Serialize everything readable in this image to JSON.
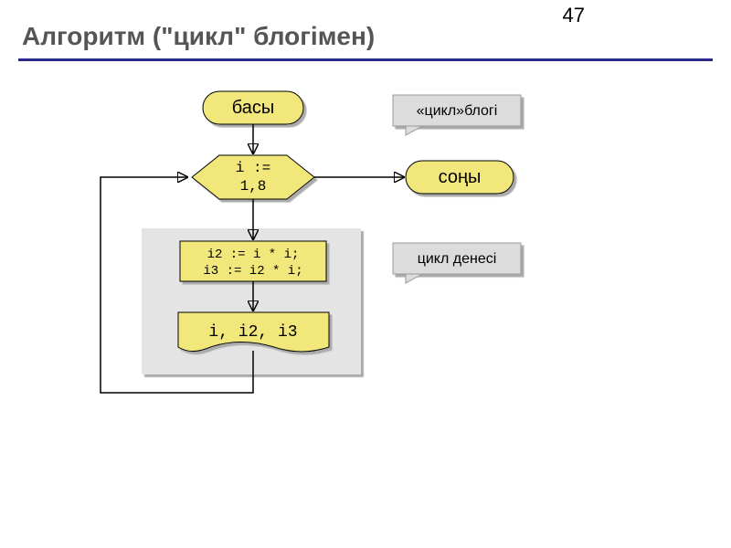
{
  "page_number": "47",
  "title": "Алгоритм (\"цикл\" блогімен)",
  "nodes": {
    "start": "басы",
    "loop_header": "i := 1,8",
    "body_line1": "i2 := i * i;",
    "body_line2": "i3 := i2 * i;",
    "output": "i, i2, i3",
    "end": "соңы"
  },
  "callouts": {
    "loop_block": "«цикл»блогі",
    "loop_body": "цикл денесі"
  },
  "colors": {
    "fill": "#f1e77a",
    "stroke": "#000",
    "body_bg": "#e4e4e4",
    "callout_bg": "#dcdcdc",
    "callout_shadow": "#b8b8b8"
  }
}
